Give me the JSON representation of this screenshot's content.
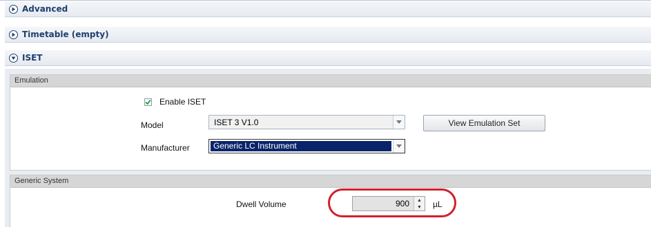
{
  "accordion": {
    "advanced": "Advanced",
    "timetable": "Timetable (empty)",
    "iset": "ISET"
  },
  "emulation": {
    "title": "Emulation",
    "enable_label": "Enable ISET",
    "enable_checked": true,
    "model_label": "Model",
    "model_value": "ISET 3 V1.0",
    "manufacturer_label": "Manufacturer",
    "manufacturer_value": "Generic LC Instrument",
    "view_button": "View Emulation Set"
  },
  "generic_system": {
    "title": "Generic System",
    "dwell_label": "Dwell Volume",
    "dwell_value": "900",
    "dwell_unit": "µL"
  },
  "colors": {
    "header_text": "#1f3f6e",
    "selection": "#0a246a",
    "highlight_ring": "#d0202a"
  }
}
